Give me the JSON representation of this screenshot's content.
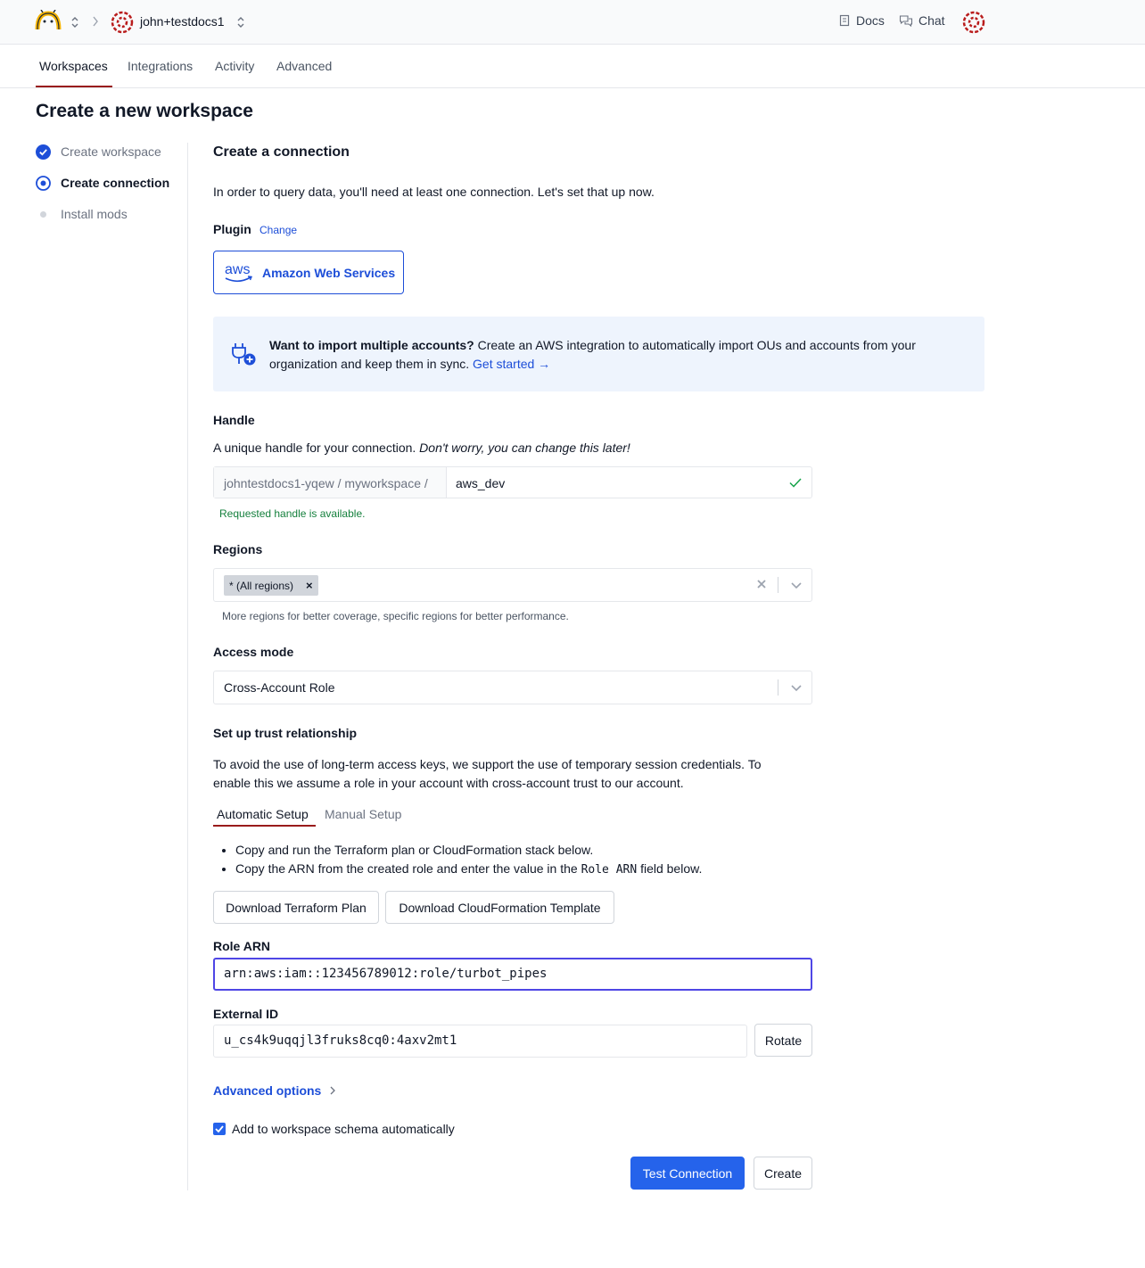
{
  "colors": {
    "accent": "#2563eb",
    "link": "#1d4ed8",
    "brand_red": "#991b1b",
    "success": "#15803d",
    "banner_bg": "#eef4fd"
  },
  "topbar": {
    "org_name": "john+testdocs1",
    "docs_label": "Docs",
    "chat_label": "Chat",
    "icons": [
      "turbot-logo-icon",
      "updown-icon",
      "chevron-right-icon",
      "org-avatar-icon",
      "docs-icon",
      "chat-icon"
    ]
  },
  "tabs": [
    {
      "label": "Workspaces",
      "active": true
    },
    {
      "label": "Integrations",
      "active": false
    },
    {
      "label": "Activity",
      "active": false
    },
    {
      "label": "Advanced",
      "active": false
    }
  ],
  "page_title": "Create a new workspace",
  "steps": [
    {
      "label": "Create workspace",
      "state": "complete"
    },
    {
      "label": "Create connection",
      "state": "current"
    },
    {
      "label": "Install mods",
      "state": "pending"
    }
  ],
  "main": {
    "heading": "Create a connection",
    "intro": "In order to query data, you'll need at least one connection. Let's set that up now.",
    "plugin": {
      "label": "Plugin",
      "change_link": "Change",
      "name": "Amazon Web Services",
      "logo_text": "aws"
    },
    "banner": {
      "bold": "Want to import multiple accounts?",
      "text": " Create an AWS integration to automatically import OUs and accounts from your organization and keep them in sync. ",
      "link": "Get started →"
    },
    "handle": {
      "label": "Handle",
      "help_plain": "A unique handle for your connection. ",
      "help_italic": "Don't worry, you can change this later!",
      "prefix": "johntestdocs1-yqew / myworkspace /",
      "value": "aws_dev",
      "status": "Requested handle is available."
    },
    "regions": {
      "label": "Regions",
      "chip": "* (All regions)",
      "chip_remove": "×",
      "help": "More regions for better coverage, specific regions for better performance."
    },
    "access_mode": {
      "label": "Access mode",
      "value": "Cross-Account Role"
    },
    "trust": {
      "label": "Set up trust relationship",
      "description_line1": "To avoid the use of long-term access keys, we support the use of temporary session credentials. To",
      "description_line2": "enable this we assume a role in your account with cross-account trust to our account.",
      "tabs": [
        {
          "label": "Automatic Setup",
          "active": true
        },
        {
          "label": "Manual Setup",
          "active": false
        }
      ],
      "bullet1": "Copy and run the Terraform plan or CloudFormation stack below.",
      "bullet2_pre": "Copy the ARN from the created role and enter the value in the ",
      "bullet2_code": "Role ARN",
      "bullet2_post": " field below.",
      "download_terraform": "Download Terraform Plan",
      "download_cloudformation": "Download CloudFormation Template"
    },
    "role_arn": {
      "label": "Role ARN",
      "value": "arn:aws:iam::123456789012:role/turbot_pipes"
    },
    "external_id": {
      "label": "External ID",
      "value": "u_cs4k9uqqjl3fruks8cq0:4axv2mt1",
      "rotate_label": "Rotate"
    },
    "advanced_options": "Advanced options",
    "schema_checkbox": {
      "label": "Add to workspace schema automatically",
      "checked": true
    },
    "test_connection": "Test Connection",
    "create": "Create"
  }
}
